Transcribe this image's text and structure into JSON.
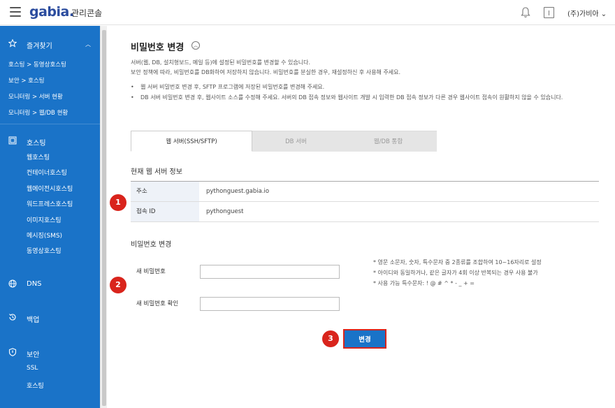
{
  "header": {
    "logo": "gabia.",
    "console_title": "관리콘솔",
    "user_menu": "(주)가비아"
  },
  "sidebar": {
    "favorites": {
      "label": "즐겨찾기",
      "links": [
        "호스팅 > 동영상호스팅",
        "보안 > 호스팅",
        "모니터링 > 서버 현황",
        "모니터링 > 웹/DB 현황"
      ]
    },
    "hosting": {
      "label": "호스팅",
      "items": [
        "웹호스팅",
        "컨테이너호스팅",
        "웹에이전시호스팅",
        "워드프레스호스팅",
        "이미지호스팅",
        "메시징(SMS)",
        "동영상호스팅"
      ]
    },
    "dns": {
      "label": "DNS"
    },
    "backup": {
      "label": "백업"
    },
    "security": {
      "label": "보안",
      "items": [
        "SSL",
        "호스팅"
      ]
    }
  },
  "main": {
    "title": "비밀번호 변경",
    "desc_lines": [
      "서버(웹, DB, 설치형보드, 메일 등)에 설정된 비밀번호를 변경할 수 있습니다.",
      "보안 정책에 따라, 비밀번호를 DB화하여 저장하지 않습니다. 비밀번호를 분실한 경우, 재설정하신 후 사용해 주세요."
    ],
    "bullets": [
      "웹 서버 비밀번호 변경 후, SFTP 프로그램에 저장된 비밀번호를 변경해 주세요.",
      "DB 서버 비밀번호 변경 후, 웹사이트 소스를 수정해 주세요. 서버의 DB 접속 정보와 웹사이트 개발 시 입력한 DB 접속 정보가 다른 경우 웹사이트 접속이 원활하지 않을 수 있습니다."
    ],
    "tabs": [
      "웹 서버(SSH/SFTP)",
      "DB 서버",
      "웹/DB 통합"
    ],
    "server_info_title": "현재 웹 서버 정보",
    "server_info": [
      {
        "key": "주소",
        "value": "pythonguest.gabia.io"
      },
      {
        "key": "접속 ID",
        "value": "pythonguest"
      }
    ],
    "password_section_title": "비밀번호 변경",
    "new_password_label": "새 비밀번호",
    "confirm_password_label": "새 비밀번호 확인",
    "new_password_value": "",
    "confirm_password_value": "",
    "hints": [
      "* 영문 소문자, 숫자, 특수문자 중 2종류를 조합하여 10~16자리로 설정",
      "* 아이디와 동일하거나, 같은 글자가 4회 이상 반복되는 경우 사용 불가",
      "* 사용 가능 특수문자: ! @ # ^ * - _ + ="
    ],
    "submit_label": "변경",
    "step_badges": [
      "1",
      "2",
      "3"
    ]
  },
  "colors": {
    "sidebar_bg": "#1a73c8",
    "badge": "#d9241c",
    "button": "#1a73c8"
  }
}
